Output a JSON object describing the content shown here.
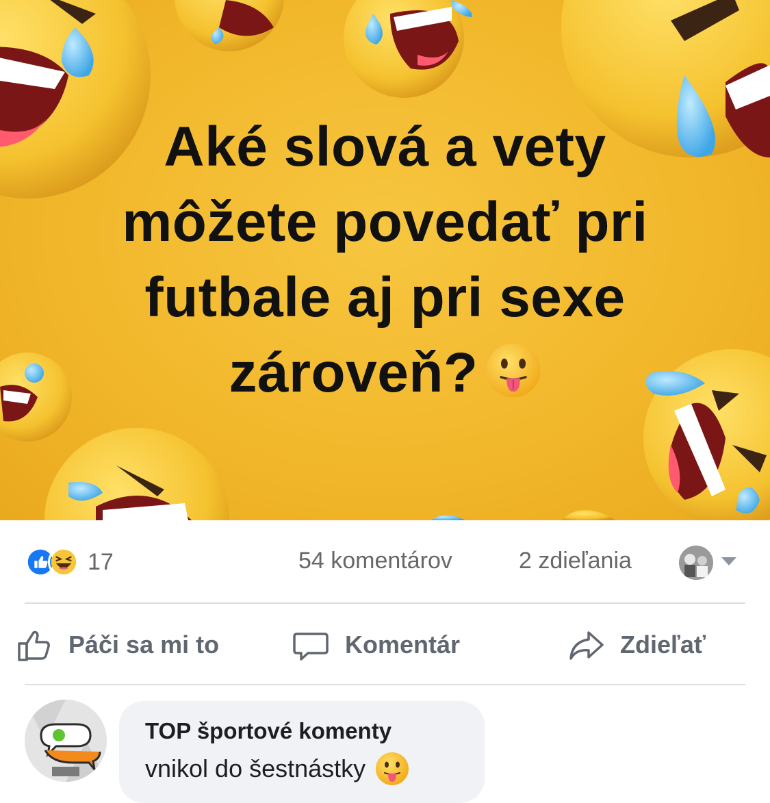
{
  "post": {
    "image_text_lines": [
      "Aké slová a vety",
      "môžete povedať pri",
      "futbale aj pri sexe",
      "zároveň?"
    ],
    "inline_emoji": "face-with-tongue-icon",
    "background_color": "#f2b82c"
  },
  "stats": {
    "reaction_icons": [
      "like-icon",
      "haha-icon"
    ],
    "reaction_count": "17",
    "comments": "54 komentárov",
    "shares": "2 zdieľania"
  },
  "actions": {
    "like_label": "Páči sa mi to",
    "comment_label": "Komentár",
    "share_label": "Zdieľať"
  },
  "comment": {
    "author": "TOP športové komenty",
    "text": "vnikol do šestnástky",
    "emoji": "face-with-tongue-icon"
  },
  "colors": {
    "like_blue": "#1877f2",
    "muted_text": "#65676b",
    "bubble_bg": "#f0f2f5"
  }
}
